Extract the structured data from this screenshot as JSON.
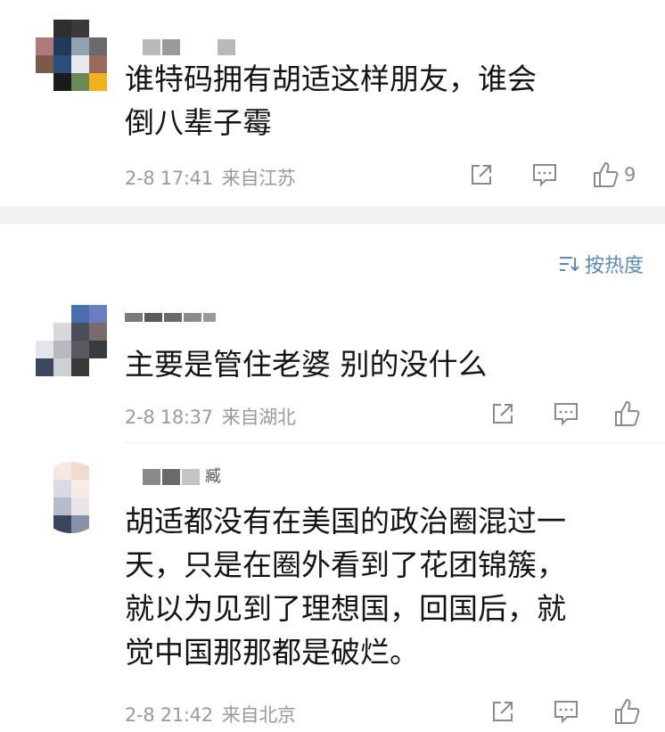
{
  "colors": {
    "text": "#141414",
    "meta": "#9a9a9a",
    "accent": "#5b8ab8",
    "separator": "#f2f2f2"
  },
  "sort": {
    "icon": "sort-icon",
    "label": "按热度"
  },
  "comments": [
    {
      "username_suffix": "",
      "text": "谁特码拥有胡适这样朋友，谁会\n倒八辈子霉",
      "date": "2-8 17:41",
      "location": "来自江苏",
      "likes": "9",
      "icons": [
        "share-icon",
        "reply-icon",
        "like-icon"
      ]
    },
    {
      "username_suffix": "",
      "text": "主要是管住老婆 别的没什么",
      "date": "2-8 18:37",
      "location": "来自湖北",
      "likes": "",
      "icons": [
        "share-icon",
        "reply-icon",
        "like-icon"
      ]
    },
    {
      "username_suffix": "臧",
      "text": "胡适都没有在美国的政治圈混过一\n天，只是在圈外看到了花团锦簇，\n就以为见到了理想国，回国后，就\n觉中国那那都是破烂。",
      "date": "2-8 21:42",
      "location": "来自北京",
      "likes": "",
      "icons": [
        "share-icon",
        "reply-icon",
        "like-icon"
      ]
    }
  ]
}
